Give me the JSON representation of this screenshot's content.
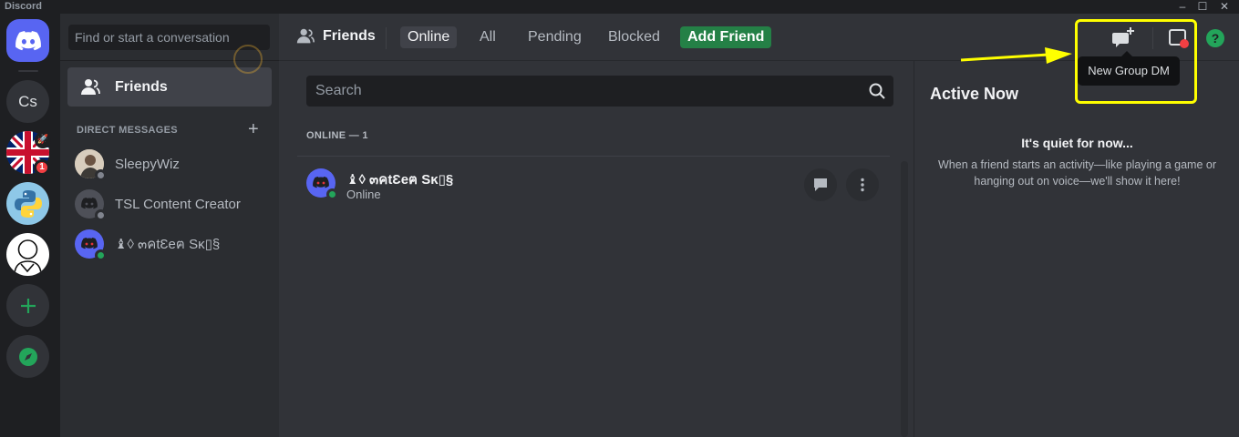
{
  "window": {
    "app_name": "Discord",
    "controls": {
      "minimize": "–",
      "maximize": "☐",
      "close": "✕"
    }
  },
  "servers": [
    {
      "label": "Cs"
    },
    {
      "badge": "1"
    }
  ],
  "dm_panel": {
    "search_placeholder": "Find or start a conversation",
    "friends_label": "Friends",
    "section_header": "DIRECT MESSAGES",
    "add_symbol": "+",
    "items": [
      {
        "name": "SleepyWiz",
        "status": "offline"
      },
      {
        "name": "TSL Content Creator",
        "status": "offline"
      },
      {
        "name": "♝◊ ๓คtƐeฅ Sĸ▯§",
        "status": "online"
      }
    ]
  },
  "topbar": {
    "title": "Friends",
    "tabs": [
      "Online",
      "All",
      "Pending",
      "Blocked"
    ],
    "active_tab": "Online",
    "add_friend": "Add Friend",
    "tooltip": "New Group DM"
  },
  "friends_list": {
    "search_placeholder": "Search",
    "online_header": "ONLINE — 1",
    "rows": [
      {
        "name": "♝◊ ๓คtƐeฅ Sĸ▯§",
        "status_text": "Online"
      }
    ]
  },
  "active_now": {
    "title": "Active Now",
    "empty_title": "It's quiet for now...",
    "empty_desc": "When a friend starts an activity—like playing a game or hanging out on voice—we'll show it here!"
  },
  "colors": {
    "blurple": "#5865f2",
    "green": "#248046",
    "online": "#23a55a",
    "offline": "#80848e",
    "highlight": "#ffff00"
  }
}
